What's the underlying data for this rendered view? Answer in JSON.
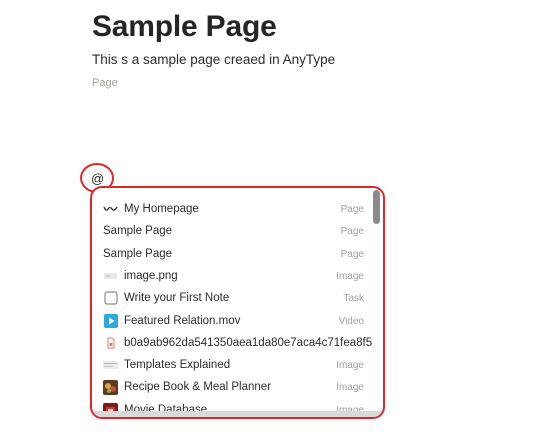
{
  "page": {
    "title": "Sample Page",
    "description": "This s a sample page creaed in AnyType",
    "type_label": "Page"
  },
  "mention": {
    "trigger": "@",
    "items": [
      {
        "name": "My Homepage",
        "kind": "Page",
        "icon": "wave-icon"
      },
      {
        "name": "Sample Page",
        "kind": "Page",
        "icon": "none"
      },
      {
        "name": "Sample Page",
        "kind": "Page",
        "icon": "none"
      },
      {
        "name": "image.png",
        "kind": "Image",
        "icon": "image-thumb-icon"
      },
      {
        "name": "Write your First Note",
        "kind": "Task",
        "icon": "checkbox-icon"
      },
      {
        "name": "Featured Relation.mov",
        "kind": "Video",
        "icon": "play-icon"
      },
      {
        "name": "b0a9ab962da541350aea1da80e7aca4c71fea8f5",
        "kind": "",
        "icon": "file-icon"
      },
      {
        "name": "Templates Explained",
        "kind": "Image",
        "icon": "template-thumb-icon"
      },
      {
        "name": "Recipe Book & Meal Planner",
        "kind": "Image",
        "icon": "recipe-thumb-icon"
      },
      {
        "name": "Movie Database",
        "kind": "Image",
        "icon": "movie-thumb-icon"
      }
    ]
  },
  "colors": {
    "highlight": "#e0262d",
    "play": "#2ea8e0"
  }
}
